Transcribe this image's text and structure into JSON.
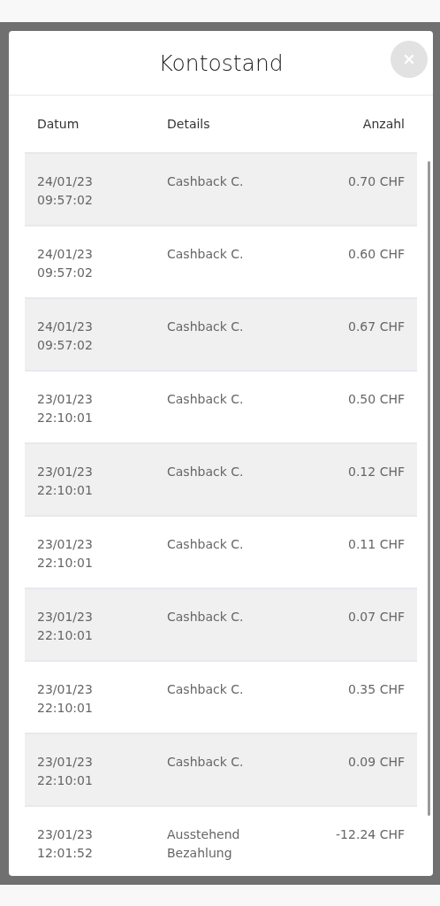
{
  "dialog": {
    "title": "Kontostand"
  },
  "table": {
    "columns": [
      "Datum",
      "Details",
      "Anzahl"
    ],
    "rows": [
      {
        "date": "24/01/23",
        "time": "09:57:02",
        "details": "Cashback C.",
        "amount": "0.70 CHF"
      },
      {
        "date": "24/01/23",
        "time": "09:57:02",
        "details": "Cashback C.",
        "amount": "0.60 CHF"
      },
      {
        "date": "24/01/23",
        "time": "09:57:02",
        "details": "Cashback C.",
        "amount": "0.67 CHF"
      },
      {
        "date": "23/01/23",
        "time": "22:10:01",
        "details": "Cashback C.",
        "amount": "0.50 CHF"
      },
      {
        "date": "23/01/23",
        "time": "22:10:01",
        "details": "Cashback C.",
        "amount": "0.12 CHF"
      },
      {
        "date": "23/01/23",
        "time": "22:10:01",
        "details": "Cashback C.",
        "amount": "0.11 CHF"
      },
      {
        "date": "23/01/23",
        "time": "22:10:01",
        "details": "Cashback C.",
        "amount": "0.07 CHF"
      },
      {
        "date": "23/01/23",
        "time": "22:10:01",
        "details": "Cashback C.",
        "amount": "0.35 CHF"
      },
      {
        "date": "23/01/23",
        "time": "22:10:01",
        "details": "Cashback C.",
        "amount": "0.09 CHF"
      },
      {
        "date": "23/01/23",
        "time": "12:01:52",
        "details": "Ausstehend Bezahlung",
        "amount": "-12.24 CHF"
      }
    ]
  }
}
